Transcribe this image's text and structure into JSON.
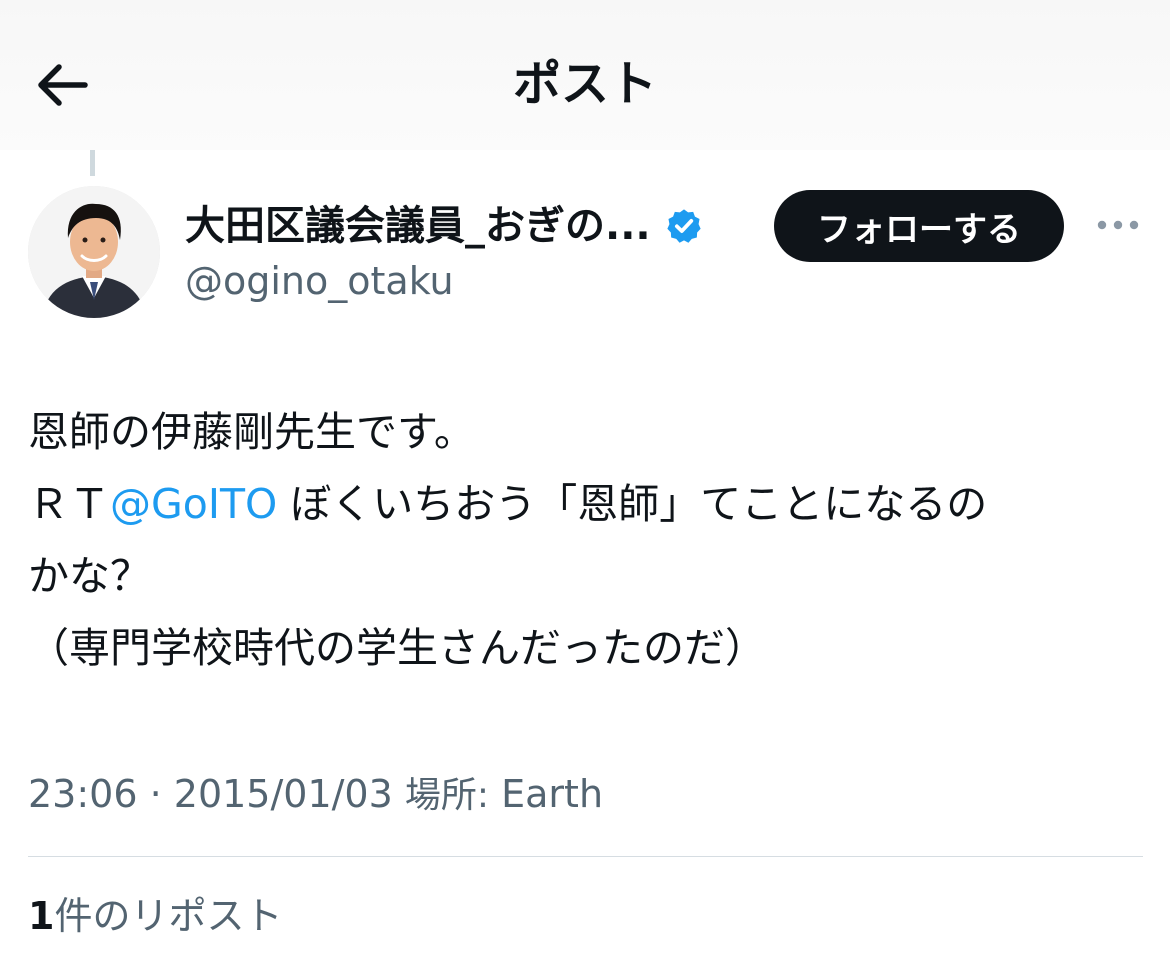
{
  "header": {
    "title": "ポスト",
    "back_icon": "arrow-left-icon"
  },
  "author": {
    "display_name": "大田区議会議員_おぎの...",
    "handle": "@ogino_otaku",
    "verified": true,
    "verified_color": "#1d9bf0"
  },
  "actions": {
    "follow_label": "フォローする",
    "more_icon": "more-horizontal-icon"
  },
  "tweet": {
    "line1": "恩師の伊藤剛先生です。",
    "line2_prefix": "ＲＴ",
    "mention": "@GoITO",
    "line2_suffix": " ぼくいちおう「恩師」てことになるの",
    "line3": "かな？",
    "line4": "（専門学校時代の学生さんだったのだ）"
  },
  "meta": {
    "time": "23:06",
    "separator": " · ",
    "date": "2015/01/03",
    "location_label": "場所:",
    "location": "Earth"
  },
  "reposts": {
    "count": "1",
    "label": "件のリポスト"
  },
  "colors": {
    "text": "#0f1419",
    "secondary": "#536471",
    "link": "#1d9bf0",
    "button_bg": "#0f1419"
  }
}
